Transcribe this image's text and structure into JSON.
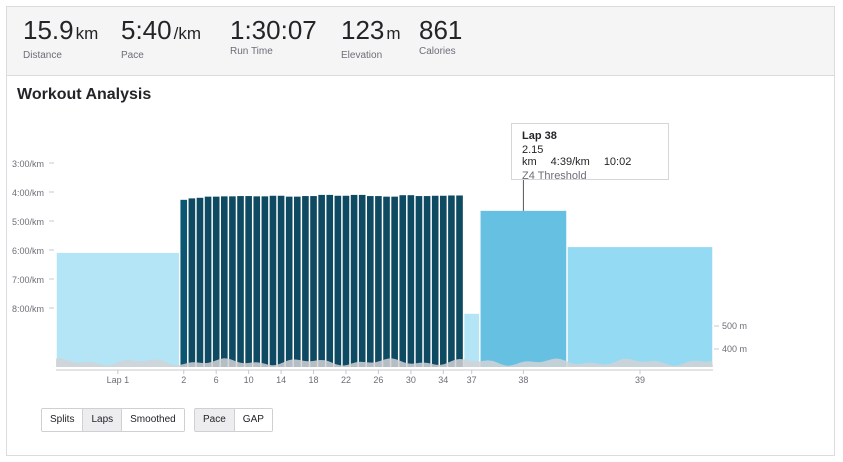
{
  "stats": [
    {
      "value": "15.9",
      "unit": "km",
      "label": "Distance"
    },
    {
      "value": "5:40",
      "unit": "/km",
      "label": "Pace"
    },
    {
      "value": "1:30:07",
      "unit": "",
      "label": "Run Time"
    },
    {
      "value": "123",
      "unit": "m",
      "label": "Elevation"
    },
    {
      "value": "861",
      "unit": "",
      "label": "Calories"
    }
  ],
  "section_title": "Workout Analysis",
  "tooltip": {
    "title": "Lap 38",
    "distance": "2.15 km",
    "pace": "4:39/km",
    "time": "10:02",
    "zone": "Z4 Threshold"
  },
  "toggles": {
    "view": [
      "Splits",
      "Laps",
      "Smoothed"
    ],
    "view_active": "Laps",
    "metric": [
      "Pace",
      "GAP"
    ],
    "metric_active": "Pace"
  },
  "colors": {
    "light_lap": "#b3e5f7",
    "mid_lap": "#93daf2",
    "highlight_lap": "#66c0e2",
    "dark_lap": "#0e4a62",
    "dark_lap_alt": "#0b5773",
    "elevation": "#d2d2d6"
  },
  "chart_data": {
    "type": "bar",
    "y_pace_ticks": [
      "3:00/km",
      "4:00/km",
      "5:00/km",
      "6:00/km",
      "7:00/km",
      "8:00/km"
    ],
    "y_elev_ticks": [
      "500 m",
      "400 m"
    ],
    "x_tick_labels": [
      "Lap 1",
      "2",
      "6",
      "10",
      "14",
      "18",
      "22",
      "26",
      "30",
      "34",
      "37",
      "38",
      "39"
    ],
    "laps": [
      {
        "lap": 1,
        "pace_min_per_km": 6.1,
        "distance_km": 3.05,
        "style": "light",
        "label": "Lap 1"
      },
      {
        "lap": 2,
        "pace_min_per_km": 4.27,
        "distance_km": 0.2,
        "style": "dark",
        "label": "2"
      },
      {
        "lap": 3,
        "pace_min_per_km": 4.22,
        "distance_km": 0.2,
        "style": "dark"
      },
      {
        "lap": 4,
        "pace_min_per_km": 4.2,
        "distance_km": 0.2,
        "style": "rest"
      },
      {
        "lap": 5,
        "pace_min_per_km": 4.16,
        "distance_km": 0.2,
        "style": "dark"
      },
      {
        "lap": 6,
        "pace_min_per_km": 4.16,
        "distance_km": 0.2,
        "style": "rest",
        "label": "6"
      },
      {
        "lap": 7,
        "pace_min_per_km": 4.15,
        "distance_km": 0.2,
        "style": "dark"
      },
      {
        "lap": 8,
        "pace_min_per_km": 4.15,
        "distance_km": 0.2,
        "style": "rest"
      },
      {
        "lap": 9,
        "pace_min_per_km": 4.14,
        "distance_km": 0.2,
        "style": "dark"
      },
      {
        "lap": 10,
        "pace_min_per_km": 4.14,
        "distance_km": 0.2,
        "style": "rest",
        "label": "10"
      },
      {
        "lap": 11,
        "pace_min_per_km": 4.15,
        "distance_km": 0.2,
        "style": "dark"
      },
      {
        "lap": 12,
        "pace_min_per_km": 4.15,
        "distance_km": 0.2,
        "style": "rest"
      },
      {
        "lap": 13,
        "pace_min_per_km": 4.13,
        "distance_km": 0.2,
        "style": "dark"
      },
      {
        "lap": 14,
        "pace_min_per_km": 4.13,
        "distance_km": 0.2,
        "style": "rest",
        "label": "14"
      },
      {
        "lap": 15,
        "pace_min_per_km": 4.16,
        "distance_km": 0.2,
        "style": "dark"
      },
      {
        "lap": 16,
        "pace_min_per_km": 4.16,
        "distance_km": 0.2,
        "style": "rest"
      },
      {
        "lap": 17,
        "pace_min_per_km": 4.14,
        "distance_km": 0.2,
        "style": "dark"
      },
      {
        "lap": 18,
        "pace_min_per_km": 4.14,
        "distance_km": 0.2,
        "style": "rest",
        "label": "18"
      },
      {
        "lap": 19,
        "pace_min_per_km": 4.1,
        "distance_km": 0.2,
        "style": "dark"
      },
      {
        "lap": 20,
        "pace_min_per_km": 4.1,
        "distance_km": 0.2,
        "style": "rest"
      },
      {
        "lap": 21,
        "pace_min_per_km": 4.13,
        "distance_km": 0.2,
        "style": "dark"
      },
      {
        "lap": 22,
        "pace_min_per_km": 4.13,
        "distance_km": 0.2,
        "style": "rest",
        "label": "22"
      },
      {
        "lap": 23,
        "pace_min_per_km": 4.1,
        "distance_km": 0.2,
        "style": "dark"
      },
      {
        "lap": 24,
        "pace_min_per_km": 4.1,
        "distance_km": 0.2,
        "style": "rest"
      },
      {
        "lap": 25,
        "pace_min_per_km": 4.14,
        "distance_km": 0.2,
        "style": "dark"
      },
      {
        "lap": 26,
        "pace_min_per_km": 4.14,
        "distance_km": 0.2,
        "style": "rest",
        "label": "26"
      },
      {
        "lap": 27,
        "pace_min_per_km": 4.16,
        "distance_km": 0.2,
        "style": "dark"
      },
      {
        "lap": 28,
        "pace_min_per_km": 4.16,
        "distance_km": 0.2,
        "style": "rest"
      },
      {
        "lap": 29,
        "pace_min_per_km": 4.11,
        "distance_km": 0.2,
        "style": "dark"
      },
      {
        "lap": 30,
        "pace_min_per_km": 4.11,
        "distance_km": 0.2,
        "style": "rest",
        "label": "30"
      },
      {
        "lap": 31,
        "pace_min_per_km": 4.14,
        "distance_km": 0.2,
        "style": "dark"
      },
      {
        "lap": 32,
        "pace_min_per_km": 4.14,
        "distance_km": 0.2,
        "style": "rest"
      },
      {
        "lap": 33,
        "pace_min_per_km": 4.13,
        "distance_km": 0.2,
        "style": "dark"
      },
      {
        "lap": 34,
        "pace_min_per_km": 4.13,
        "distance_km": 0.2,
        "style": "rest",
        "label": "34"
      },
      {
        "lap": 35,
        "pace_min_per_km": 4.12,
        "distance_km": 0.2,
        "style": "dark"
      },
      {
        "lap": 36,
        "pace_min_per_km": 4.12,
        "distance_km": 0.2,
        "style": "rest"
      },
      {
        "lap": 37,
        "pace_min_per_km": 8.2,
        "distance_km": 0.4,
        "style": "rest_light",
        "label": "37"
      },
      {
        "lap": 38,
        "pace_min_per_km": 4.65,
        "distance_km": 2.15,
        "style": "highlight",
        "label": "38"
      },
      {
        "lap": 39,
        "pace_min_per_km": 5.9,
        "distance_km": 3.6,
        "style": "mid",
        "label": "39"
      }
    ]
  }
}
